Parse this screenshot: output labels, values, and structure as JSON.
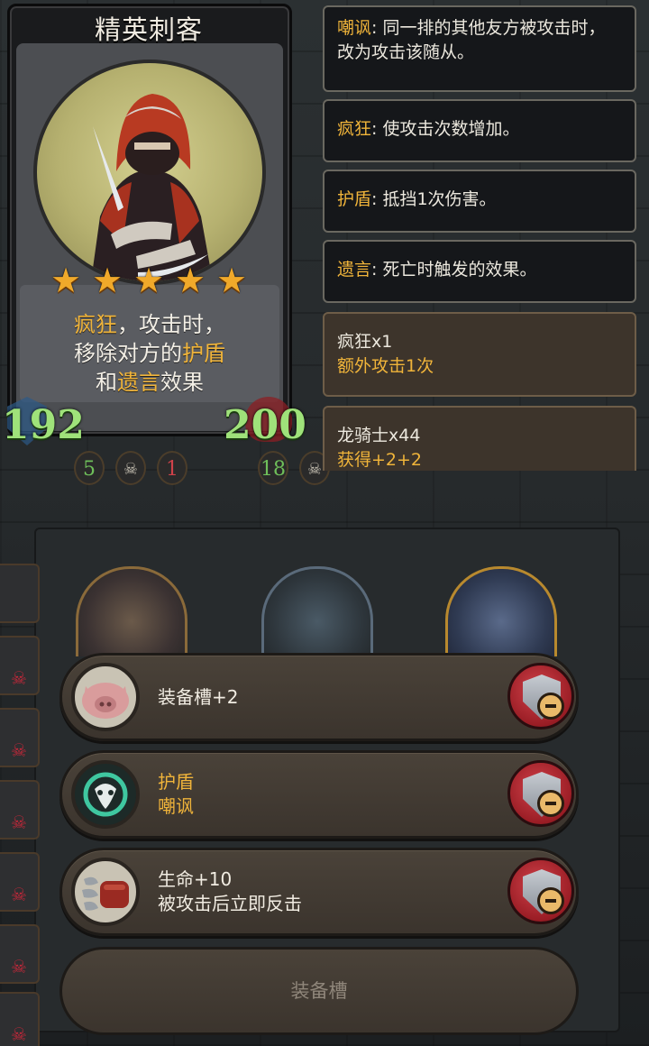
{
  "hero": {
    "name": "精英刺客",
    "stars": 5,
    "ability": {
      "line1_kw": "疯狂",
      "line1_rest": "，攻击时，",
      "line2_pre": "移除对方的",
      "line2_kw": "护盾",
      "line3_pre": "和",
      "line3_kw": "遗言",
      "line3_post": "效果"
    },
    "attack": "192",
    "health": "200"
  },
  "tooltips": [
    {
      "keyword": "嘲讽",
      "desc": ": 同一排的其他友方被攻击时，改为攻击该随从。"
    },
    {
      "keyword": "疯狂",
      "desc": ": 使攻击次数增加。"
    },
    {
      "keyword": "护盾",
      "desc": ": 抵挡1次伤害。"
    },
    {
      "keyword": "遗言",
      "desc": ": 死亡时触发的效果。"
    }
  ],
  "buffs": [
    {
      "title": "疯狂x1",
      "detail": "额外攻击1次"
    },
    {
      "title": "龙骑士x44",
      "detail": "获得+2+2"
    }
  ],
  "board_badges": [
    "5",
    "1",
    "18"
  ],
  "equipment": [
    {
      "icon": "pig-icon",
      "line1": "装备槽+2",
      "line2": ""
    },
    {
      "icon": "green-crest-icon",
      "line1": "护盾",
      "line2": "嘲讽"
    },
    {
      "icon": "armored-fist-icon",
      "line1": "生命+10",
      "line2": "被攻击后立即反击"
    }
  ],
  "empty_slot_label": "装备槽",
  "colors": {
    "keyword": "#f0b43a",
    "stat_green": "#9fe27a",
    "remove_red": "#b0252e"
  }
}
